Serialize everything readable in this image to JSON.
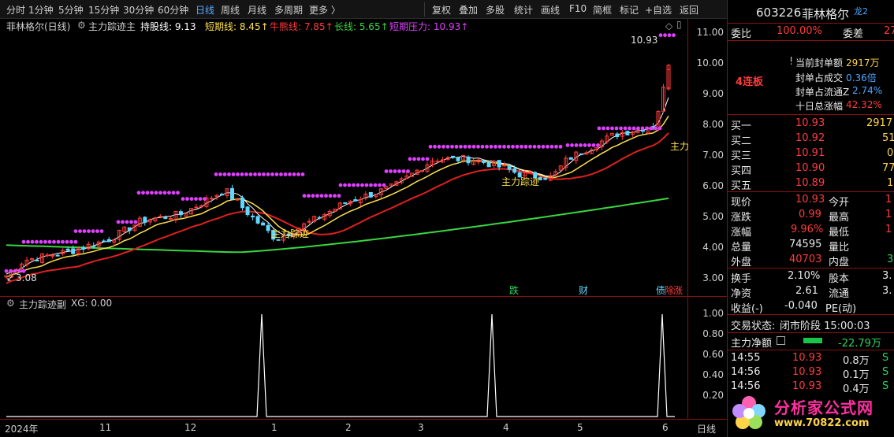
{
  "toolbar": {
    "periods": [
      "分时",
      "1分钟",
      "5分钟",
      "15分钟",
      "30分钟",
      "60分钟",
      "日线",
      "周线",
      "月线",
      "多周期",
      "更多 〉"
    ],
    "active": "日线",
    "tools": [
      "复权",
      "叠加",
      "多股",
      "统计",
      "画线",
      "F10",
      "简框",
      "标记",
      "+自选",
      "返回"
    ]
  },
  "main": {
    "stock_label": "菲林格尔(日线)",
    "indicator": "主力踪迹主",
    "hold_line": "持股线: 9.13",
    "short_line": "短期线: 8.45↑",
    "bull_line": "牛熊线: 7.85↑",
    "long_line": "长线: 5.65↑",
    "short_pressure": "短期压力: 10.93↑",
    "price_max_label": "10.93",
    "price_min_label": "3.08",
    "annot1": "主力踪迹",
    "annot2": "主力踪迹",
    "annot3": "主力",
    "yticks": [
      "11.00",
      "10.00",
      "9.00",
      "8.00",
      "7.00",
      "6.00",
      "5.00",
      "4.00",
      "3.00"
    ],
    "markers": [
      "跌",
      "财",
      "债",
      "除",
      "涨"
    ]
  },
  "sub": {
    "title": "主力踪迹副",
    "xg": "XG: 0.00",
    "yticks": [
      "1.00",
      "0.80",
      "0.60",
      "0.40",
      "0.20"
    ]
  },
  "time_axis": {
    "labels": [
      "2024年",
      "11",
      "12",
      "1",
      "2",
      "3",
      "4",
      "5",
      "6"
    ],
    "period": "日线"
  },
  "panel": {
    "code": "603226",
    "name": "菲林格尔",
    "tag": "龙2",
    "weibi_label": "委比",
    "weibi": "100.00%",
    "weicha_label": "委差",
    "weicha": "27",
    "streak": "4连板",
    "info": [
      {
        "label": "当前封单额",
        "value": "2917万",
        "color": "yellow"
      },
      {
        "label": "封单占成交",
        "value": "0.36倍",
        "color": "blue"
      },
      {
        "label": "封单占流通Z",
        "value": "2.74%",
        "color": "blue"
      },
      {
        "label": "十日总涨幅",
        "value": "42.32%",
        "color": "red"
      }
    ],
    "buy": [
      {
        "label": "买一",
        "price": "10.93",
        "vol": "2917"
      },
      {
        "label": "买二",
        "price": "10.92",
        "vol": "51"
      },
      {
        "label": "买三",
        "price": "10.91",
        "vol": "0"
      },
      {
        "label": "买四",
        "price": "10.90",
        "vol": "77"
      },
      {
        "label": "买五",
        "price": "10.89",
        "vol": "1"
      }
    ],
    "quote": [
      {
        "l1": "现价",
        "v1": "10.93",
        "c1": "red",
        "l2": "今开",
        "v2": "1"
      },
      {
        "l1": "涨跌",
        "v1": "0.99",
        "c1": "red",
        "l2": "最高",
        "v2": "1"
      },
      {
        "l1": "涨幅",
        "v1": "9.96%",
        "c1": "red",
        "l2": "最低",
        "v2": "1"
      },
      {
        "l1": "总量",
        "v1": "74595",
        "c1": "white",
        "l2": "量比",
        "v2": ""
      },
      {
        "l1": "外盘",
        "v1": "40703",
        "c1": "red",
        "l2": "内盘",
        "v2": "3"
      }
    ],
    "fin": [
      {
        "l1": "换手",
        "v1": "2.10%",
        "l2": "股本",
        "v2": "3."
      },
      {
        "l1": "净资",
        "v1": "2.61",
        "l2": "流通",
        "v2": "3."
      },
      {
        "l1": "收益(-)",
        "v1": "-0.040",
        "l2": "PE(动)",
        "v2": ""
      }
    ],
    "trade_status_label": "交易状态:",
    "trade_status": "闭市阶段 15:00:03",
    "net_label": "主力净额",
    "net_value": "-22.79万",
    "ticks": [
      {
        "time": "14:55",
        "price": "10.93",
        "vol": "0.8万",
        "side": "S"
      },
      {
        "time": "14:56",
        "price": "10.93",
        "vol": "0.1万",
        "side": "S"
      },
      {
        "time": "14:56",
        "price": "10.93",
        "vol": "0.4万",
        "side": "S"
      }
    ],
    "watermark_cn": "分析家公式网",
    "watermark_url": "www.70822.com"
  },
  "colors": {
    "up": "#ff3b3b",
    "down": "#5fd7ff",
    "hold": "#ffffff",
    "short": "#ffe14a",
    "bull": "#e02020",
    "long": "#39d640",
    "pressure": "#e040ff"
  }
}
